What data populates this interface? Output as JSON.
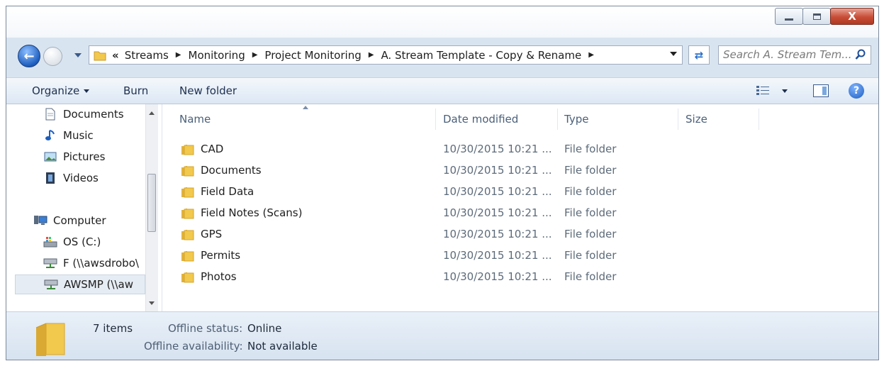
{
  "window": {
    "controls": {
      "minimize": "minimize",
      "maximize": "maximize",
      "close": "X"
    }
  },
  "nav": {
    "back_icon": "back-arrow-icon",
    "breadcrumb_prefix": "«",
    "breadcrumbs": [
      "Streams",
      "Monitoring",
      "Project Monitoring",
      "A. Stream Template - Copy & Rename"
    ],
    "search_placeholder": "Search A. Stream Tem..."
  },
  "toolbar": {
    "organize": "Organize",
    "burn": "Burn",
    "new_folder": "New folder"
  },
  "sidebar": {
    "items": [
      {
        "label": "Documents",
        "icon": "documents-icon"
      },
      {
        "label": "Music",
        "icon": "music-icon"
      },
      {
        "label": "Pictures",
        "icon": "pictures-icon"
      },
      {
        "label": "Videos",
        "icon": "videos-icon"
      },
      {
        "label": "Computer",
        "icon": "computer-icon"
      },
      {
        "label": "OS (C:)",
        "icon": "drive-icon"
      },
      {
        "label": "F (\\\\awsdrobo\\",
        "icon": "network-drive-icon"
      },
      {
        "label": "AWSMP (\\\\aw",
        "icon": "network-drive-icon"
      }
    ]
  },
  "table": {
    "columns": {
      "name": "Name",
      "date": "Date modified",
      "type": "Type",
      "size": "Size"
    },
    "rows": [
      {
        "name": "CAD",
        "date": "10/30/2015 10:21 ...",
        "type": "File folder"
      },
      {
        "name": "Documents",
        "date": "10/30/2015 10:21 ...",
        "type": "File folder"
      },
      {
        "name": "Field Data",
        "date": "10/30/2015 10:21 ...",
        "type": "File folder"
      },
      {
        "name": "Field Notes (Scans)",
        "date": "10/30/2015 10:21 ...",
        "type": "File folder"
      },
      {
        "name": "GPS",
        "date": "10/30/2015 10:21 ...",
        "type": "File folder"
      },
      {
        "name": "Permits",
        "date": "10/30/2015 10:21 ...",
        "type": "File folder"
      },
      {
        "name": "Photos",
        "date": "10/30/2015 10:21 ...",
        "type": "File folder"
      }
    ]
  },
  "details": {
    "count": "7 items",
    "offline_status_label": "Offline status:",
    "offline_status_value": "Online",
    "offline_availability_label": "Offline availability:",
    "offline_availability_value": "Not available"
  },
  "colors": {
    "folder": "#f2c94c",
    "accent": "#1e5fc0",
    "toolbar": "#dce7f4"
  }
}
